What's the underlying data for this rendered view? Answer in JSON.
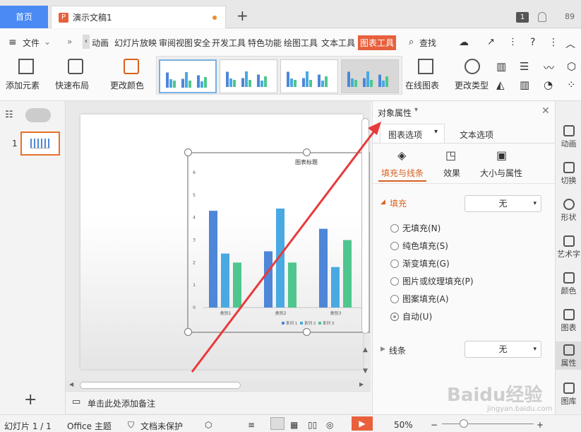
{
  "tabs": {
    "home": "首页",
    "doc": "演示文稿1",
    "count_badge": "1",
    "count_num": "89"
  },
  "menu": {
    "file": "文件",
    "items": [
      "动画",
      "幻灯片放映",
      "审阅",
      "视图",
      "安全",
      "开发工具",
      "特色功能",
      "绘图工具",
      "文本工具",
      "图表工具"
    ],
    "search": "查找"
  },
  "ribbon": {
    "add_element": "添加元素",
    "quick_layout": "快速布局",
    "change_color": "更改颜色",
    "online_chart": "在线图表",
    "change_type": "更改类型"
  },
  "slides_panel": {
    "slide_number": "1"
  },
  "chart_data": {
    "type": "bar",
    "title": "图表标题",
    "categories": [
      "类别1",
      "类别2",
      "类别3"
    ],
    "series": [
      {
        "name": "系列 1",
        "values": [
          4.3,
          2.5,
          3.5
        ]
      },
      {
        "name": "系列 2",
        "values": [
          2.4,
          4.4,
          1.8
        ]
      },
      {
        "name": "系列 3",
        "values": [
          2,
          2,
          3
        ]
      }
    ],
    "yticks": [
      "0",
      "1",
      "2",
      "3",
      "4",
      "5",
      "6"
    ],
    "ylim": [
      0,
      6
    ],
    "colors": [
      "#4e86d8",
      "#49a9e2",
      "#4fc68e"
    ],
    "legend": "bottom"
  },
  "notes": {
    "placeholder": "单击此处添加备注"
  },
  "panel": {
    "title": "对象属性",
    "tab_chart": "图表选项",
    "tab_text": "文本选项",
    "sub_fill_line": "填充与线条",
    "sub_effect": "效果",
    "sub_size": "大小与属性",
    "fill_label": "填充",
    "fill_value": "无",
    "fill_options": [
      "无填充(N)",
      "纯色填充(S)",
      "渐变填充(G)",
      "图片或纹理填充(P)",
      "图案填充(A)",
      "自动(U)"
    ],
    "line_label": "线条",
    "line_value": "无",
    "accent": "#d9611f"
  },
  "sidebar": [
    "动画",
    "切换",
    "形状",
    "艺术字",
    "颜色",
    "图表",
    "属性",
    "图库"
  ],
  "status": {
    "slide": "幻灯片 1 / 1",
    "theme": "Office 主题",
    "protect": "文档未保护",
    "zoom": "50%"
  },
  "watermark": {
    "text": "Baidu经验",
    "url": "jingyan.baidu.com"
  }
}
